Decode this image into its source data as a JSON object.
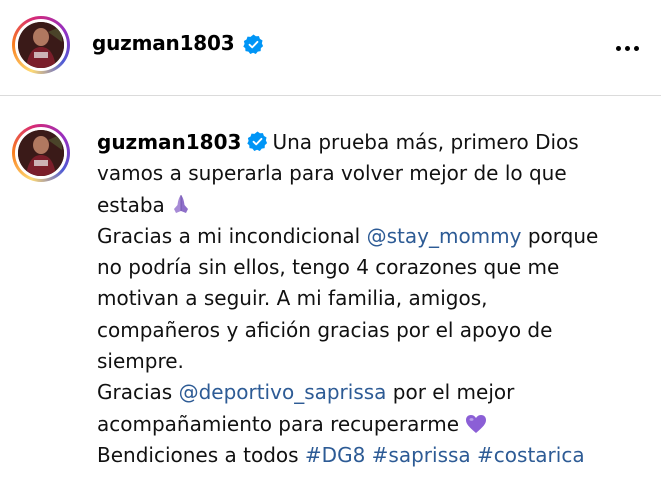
{
  "header": {
    "username": "guzman1803"
  },
  "caption": {
    "username": "guzman1803",
    "line1": "Una prueba más, primero Dios",
    "line2": "vamos a superarla para volver mejor de lo que",
    "line3": "estaba",
    "line4_pre": "Gracias a mi incondicional ",
    "line4_mention": "@stay_mommy",
    "line4_post": " porque",
    "line5": "no podría sin ellos, tengo 4 corazones que me",
    "line6": "motivan a seguir. A mi familia, amigos,",
    "line7": "compañeros y afición gracias por el apoyo de",
    "line8": "siempre.",
    "line9_pre": "Gracias ",
    "line9_mention": "@deportivo_saprissa",
    "line9_post": " por el mejor",
    "line10": "acompañamiento para recuperarme",
    "line11_pre": "Bendiciones a todos ",
    "hashtag1": "#DG8",
    "hashtag2": "#saprissa",
    "hashtag3": "#costarica"
  },
  "colors": {
    "link": "#2d5b95",
    "verified": "#0095f6",
    "heart": "#8b5fd6",
    "hands": "#a78bd6"
  },
  "icons": {
    "verified": "verified-badge-icon",
    "more": "more-options-icon",
    "praying_hands": "praying-hands-emoji",
    "heart": "purple-heart-emoji"
  }
}
